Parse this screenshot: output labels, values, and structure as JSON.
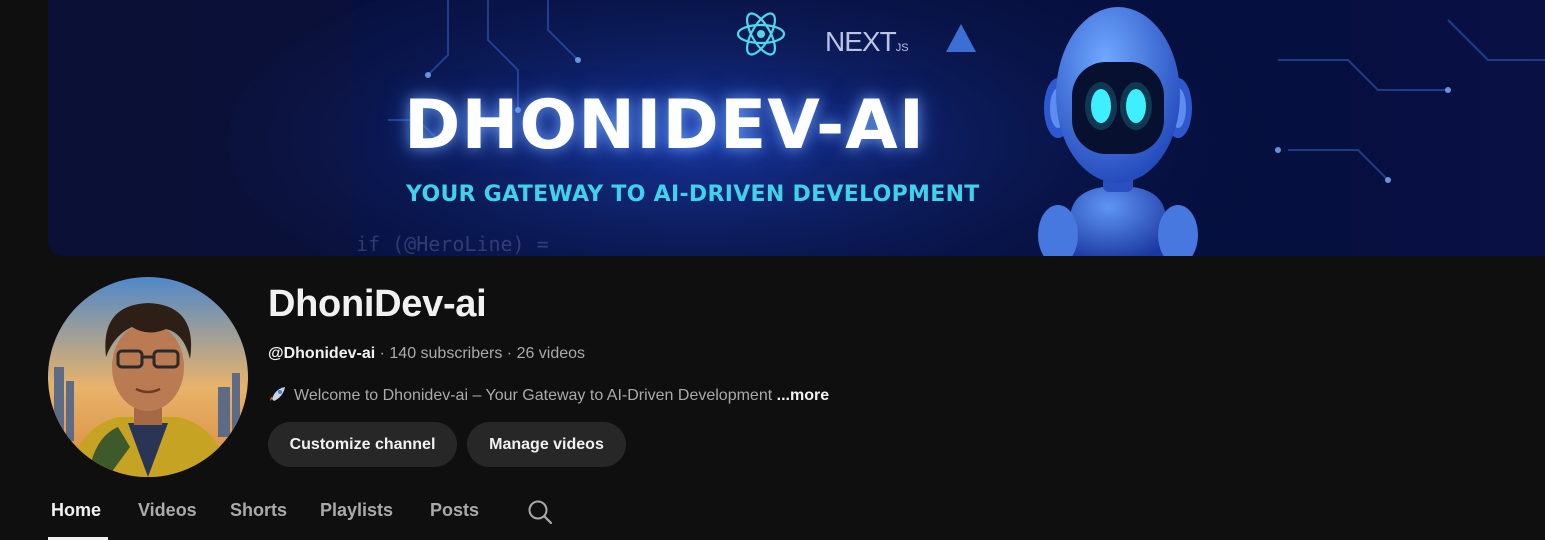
{
  "banner": {
    "title": "DHONIDEV-AI",
    "subtitle": "YOUR GATEWAY TO AI-DRIVEN DEVELOPMENT",
    "code_snippet": "if (@HeroLine) =",
    "logos": {
      "next_main": "NEXT",
      "next_sub": "JS"
    },
    "colors": {
      "background": "#060a2a",
      "accent": "#3fd2ec",
      "robot_eye": "#3ff0ff"
    }
  },
  "channel": {
    "name": "DhoniDev-ai",
    "handle": "@Dhonidev-ai",
    "subscribers": "140 subscribers",
    "videos": "26 videos",
    "separator": " · ",
    "description": "Welcome to Dhonidev-ai – Your Gateway to AI-Driven Development",
    "more_label": "...more",
    "description_icon": "rocket-icon"
  },
  "buttons": {
    "customize": "Customize channel",
    "manage": "Manage videos"
  },
  "tabs": [
    {
      "label": "Home",
      "active": true
    },
    {
      "label": "Videos",
      "active": false
    },
    {
      "label": "Shorts",
      "active": false
    },
    {
      "label": "Playlists",
      "active": false
    },
    {
      "label": "Posts",
      "active": false
    }
  ],
  "search_icon": "search-icon"
}
